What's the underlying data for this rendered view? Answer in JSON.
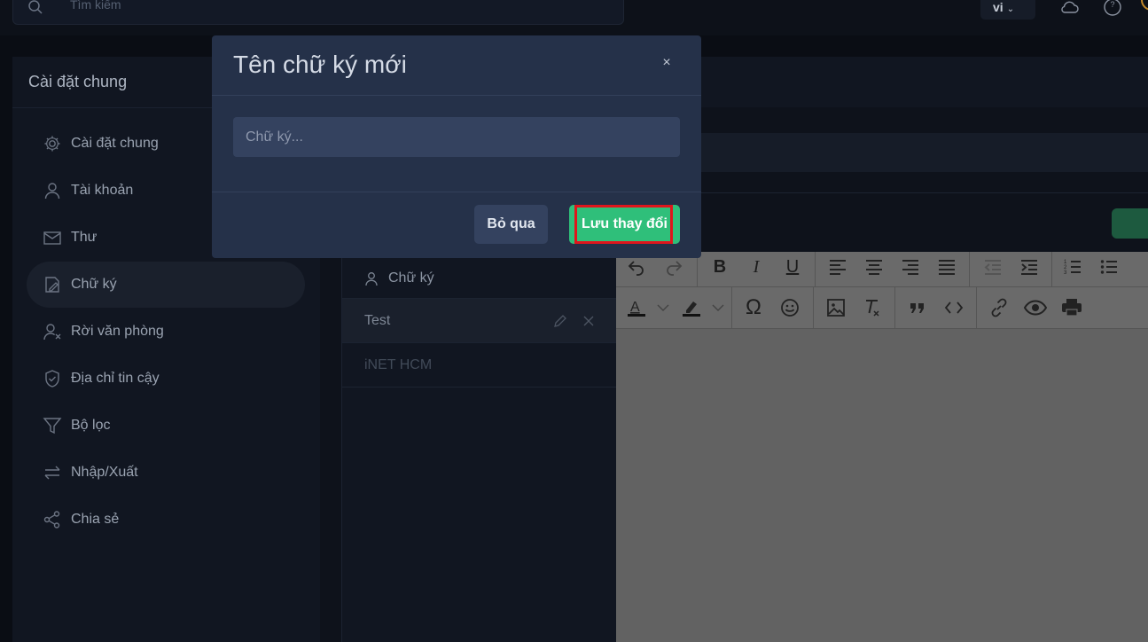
{
  "topbar": {
    "search_placeholder": "Tìm kiếm",
    "language": "vi",
    "icons": [
      "search-icon",
      "cloud-icon",
      "help-icon"
    ]
  },
  "settings": {
    "title": "Cài đặt chung",
    "items": [
      {
        "label": "Cài đặt chung",
        "icon": "gear-icon",
        "active": false
      },
      {
        "label": "Tài khoản",
        "icon": "user-icon",
        "active": false
      },
      {
        "label": "Thư",
        "icon": "mail-icon",
        "active": false
      },
      {
        "label": "Chữ ký",
        "icon": "signature-icon",
        "active": true
      },
      {
        "label": "Rời văn phòng",
        "icon": "user-x-icon",
        "active": false
      },
      {
        "label": "Địa chỉ tin cậy",
        "icon": "shield-icon",
        "active": false
      },
      {
        "label": "Bộ lọc",
        "icon": "filter-icon",
        "active": false
      },
      {
        "label": "Nhập/Xuất",
        "icon": "swap-icon",
        "active": false
      },
      {
        "label": "Chia sẻ",
        "icon": "share-icon",
        "active": false
      }
    ]
  },
  "signature_list": {
    "header": "Chữ ký",
    "rows": [
      {
        "label": "Test",
        "active": true
      },
      {
        "label": "iNET HCM",
        "active": false
      }
    ]
  },
  "editor": {
    "toolbar_row1": [
      "undo-icon",
      "redo-icon",
      "bold-icon",
      "italic-icon",
      "underline-icon",
      "align-left-icon",
      "align-center-icon",
      "align-right-icon",
      "align-justify-icon",
      "outdent-icon",
      "indent-icon",
      "ordered-list-icon",
      "bullet-list-icon"
    ],
    "toolbar_row2": [
      "text-color-icon",
      "highlight-icon",
      "special-char-icon",
      "emoji-icon",
      "image-icon",
      "clear-format-icon",
      "blockquote-icon",
      "code-icon",
      "link-icon",
      "preview-icon",
      "print-icon"
    ]
  },
  "modal": {
    "title": "Tên chữ ký mới",
    "close": "×",
    "input_placeholder": "Chữ ký...",
    "input_value": "",
    "cancel_label": "Bỏ qua",
    "save_label": "Lưu thay đổi",
    "save_color": "#2fbf7a",
    "highlight_color": "#e0151c"
  }
}
